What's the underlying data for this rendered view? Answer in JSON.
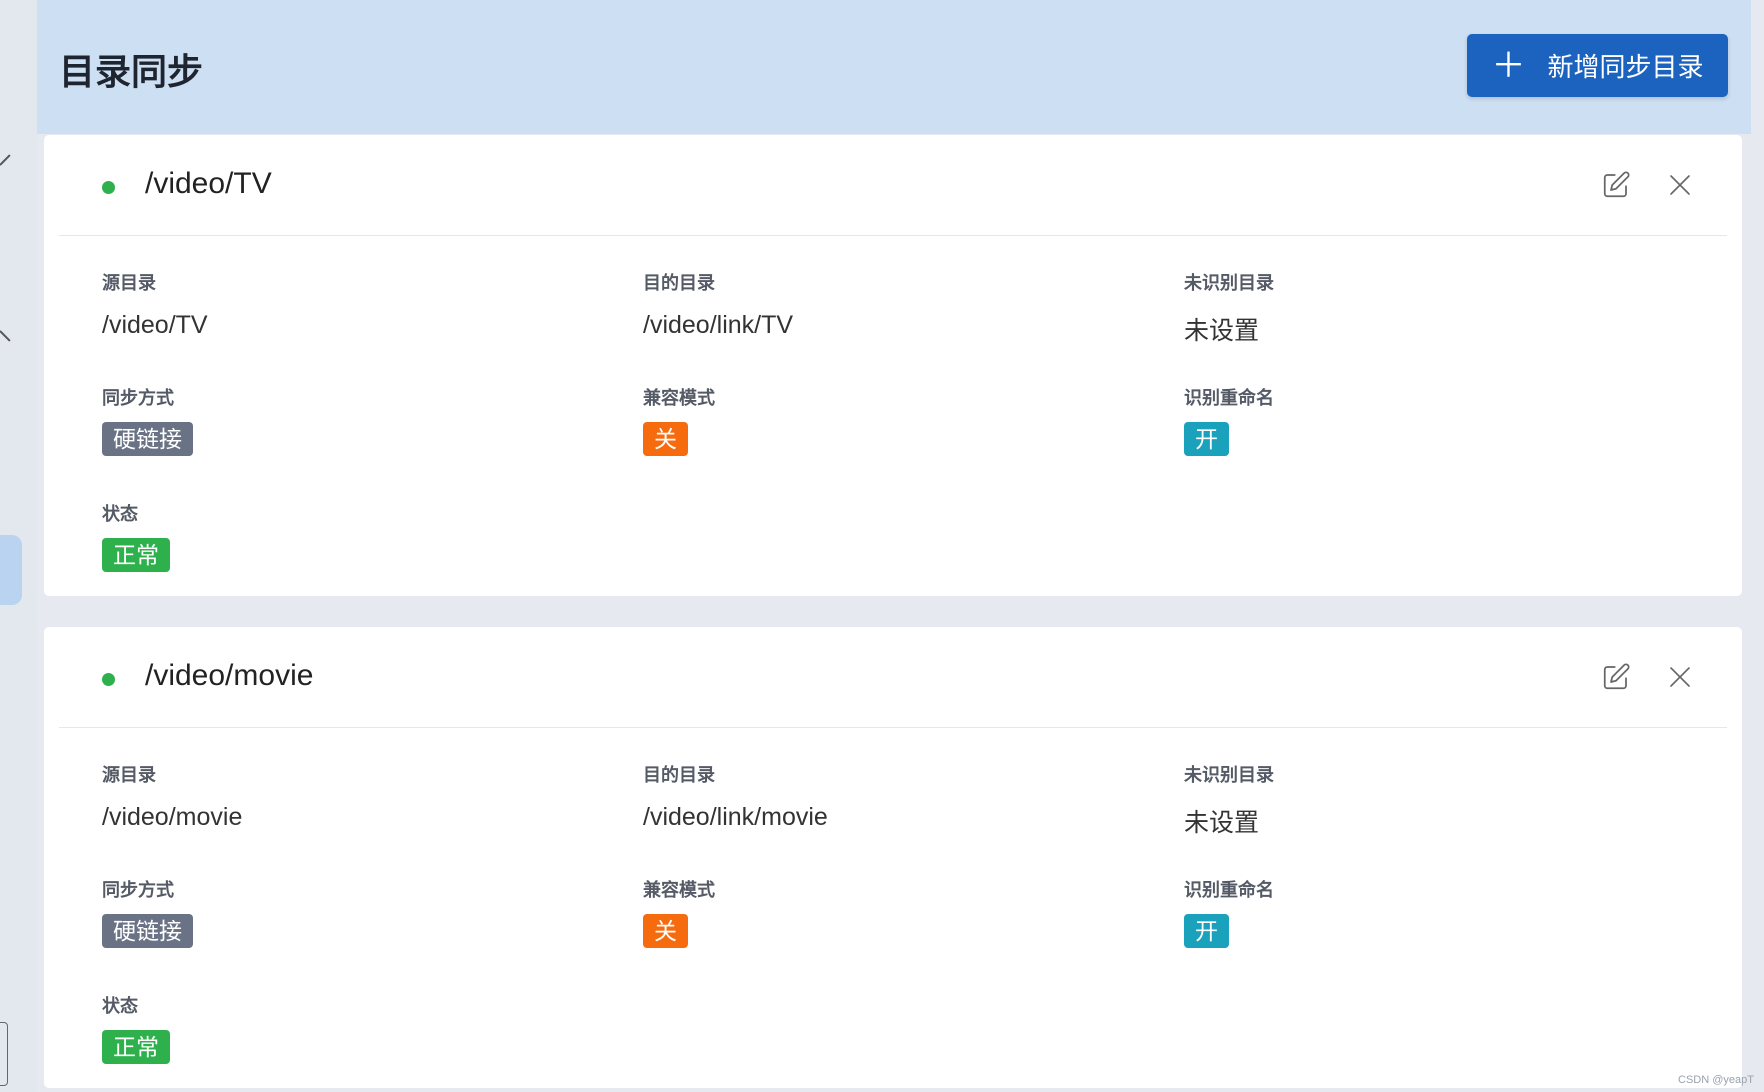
{
  "header": {
    "title": "目录同步",
    "add_button_label": "新增同步目录"
  },
  "cards": [
    {
      "title": "/video/TV",
      "source_label": "源目录",
      "source_value": "/video/TV",
      "dest_label": "目的目录",
      "dest_value": "/video/link/TV",
      "unknown_label": "未识别目录",
      "unknown_value": "未设置",
      "sync_mode_label": "同步方式",
      "sync_mode_value": "硬链接",
      "compat_label": "兼容模式",
      "compat_value": "关",
      "rename_label": "识别重命名",
      "rename_value": "开",
      "state_label": "状态",
      "state_value": "正常"
    },
    {
      "title": "/video/movie",
      "source_label": "源目录",
      "source_value": "/video/movie",
      "dest_label": "目的目录",
      "dest_value": "/video/link/movie",
      "unknown_label": "未识别目录",
      "unknown_value": "未设置",
      "sync_mode_label": "同步方式",
      "sync_mode_value": "硬链接",
      "compat_label": "兼容模式",
      "compat_value": "关",
      "rename_label": "识别重命名",
      "rename_value": "开",
      "state_label": "状态",
      "state_value": "正常"
    }
  ],
  "colors": {
    "primary": "#1c63bf",
    "status_ok": "#2eb14d",
    "tag_gray": "#6a7385",
    "tag_orange": "#f76b0f",
    "tag_teal": "#1aa2bc",
    "header_bg": "#cddff2"
  },
  "icons": {
    "add": "plus-icon",
    "edit": "edit-icon",
    "delete": "close-icon"
  },
  "watermark": "CSDN @yeapT"
}
